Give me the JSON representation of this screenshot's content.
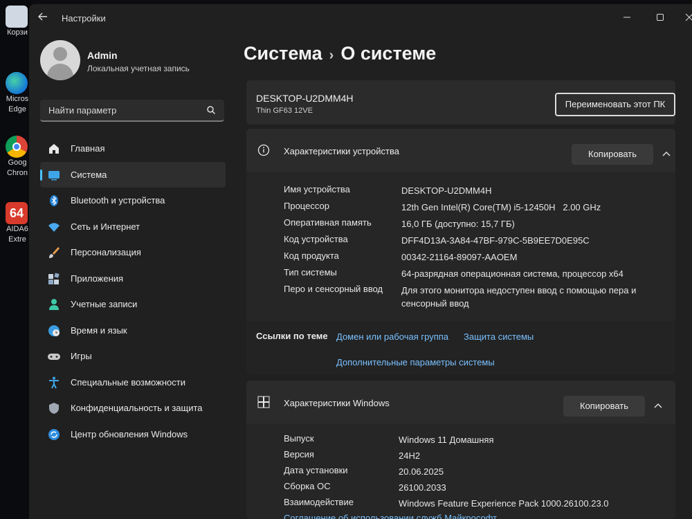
{
  "desktop": {
    "icons": [
      {
        "label": "Корзи",
        "icon": "recycle-bin-icon"
      },
      {
        "label": "Micros Edge",
        "icon": "edge-icon"
      },
      {
        "label": "Goog Chron",
        "icon": "chrome-icon"
      },
      {
        "label": "AIDA6 Extre",
        "icon": "aida64-icon"
      }
    ]
  },
  "window": {
    "title": "Настройки",
    "controls": [
      "minimize",
      "maximize",
      "close"
    ]
  },
  "profile": {
    "name": "Admin",
    "subtitle": "Локальная учетная запись"
  },
  "search": {
    "placeholder": "Найти параметр"
  },
  "nav": {
    "items": [
      {
        "label": "Главная",
        "icon": "home-icon"
      },
      {
        "label": "Система",
        "icon": "system-icon",
        "active": true
      },
      {
        "label": "Bluetooth и устройства",
        "icon": "bluetooth-icon"
      },
      {
        "label": "Сеть и Интернет",
        "icon": "wifi-icon"
      },
      {
        "label": "Персонализация",
        "icon": "brush-icon"
      },
      {
        "label": "Приложения",
        "icon": "apps-icon"
      },
      {
        "label": "Учетные записи",
        "icon": "account-icon"
      },
      {
        "label": "Время и язык",
        "icon": "globe-clock-icon"
      },
      {
        "label": "Игры",
        "icon": "gamepad-icon"
      },
      {
        "label": "Специальные возможности",
        "icon": "accessibility-icon"
      },
      {
        "label": "Конфиденциальность и защита",
        "icon": "shield-icon"
      },
      {
        "label": "Центр обновления Windows",
        "icon": "update-icon"
      }
    ]
  },
  "breadcrumb": {
    "parent": "Система",
    "separator": "›",
    "current": "О системе"
  },
  "device": {
    "name": "DESKTOP-U2DMM4H",
    "model": "Thin GF63 12VE",
    "rename_button": "Переименовать этот ПК"
  },
  "device_specs": {
    "title": "Характеристики устройства",
    "copy_button": "Копировать",
    "rows": [
      {
        "key": "Имя устройства",
        "value": "DESKTOP-U2DMM4H"
      },
      {
        "key": "Процессор",
        "value": "12th Gen Intel(R) Core(TM) i5-12450H   2.00 GHz"
      },
      {
        "key": "Оперативная память",
        "value": "16,0 ГБ (доступно: 15,7 ГБ)"
      },
      {
        "key": "Код устройства",
        "value": "DFF4D13A-3A84-47BF-979C-5B9EE7D0E95C"
      },
      {
        "key": "Код продукта",
        "value": "00342-21164-89097-AAOEM"
      },
      {
        "key": "Тип системы",
        "value": "64-разрядная операционная система, процессор x64"
      },
      {
        "key": "Перо и сенсорный ввод",
        "value": "Для этого монитора недоступен ввод с помощью пера и сенсорный ввод"
      }
    ]
  },
  "related_links": {
    "label": "Ссылки по теме",
    "links": [
      "Домен или рабочая группа",
      "Защита системы",
      "Дополнительные параметры системы"
    ]
  },
  "windows_specs": {
    "title": "Характеристики Windows",
    "copy_button": "Копировать",
    "rows": [
      {
        "key": "Выпуск",
        "value": "Windows 11 Домашняя"
      },
      {
        "key": "Версия",
        "value": "24H2"
      },
      {
        "key": "Дата установки",
        "value": "20.06.2025"
      },
      {
        "key": "Сборка ОС",
        "value": "26100.2033"
      },
      {
        "key": "Взаимодействие",
        "value": "Windows Feature Experience Pack 1000.26100.23.0"
      }
    ],
    "agreement_link": "Соглашение об использовании служб Майкрософт"
  },
  "colors": {
    "accent": "#4cc2ff",
    "link": "#79c0ff",
    "window_bg": "#202020",
    "card_bg": "#2b2b2b"
  }
}
